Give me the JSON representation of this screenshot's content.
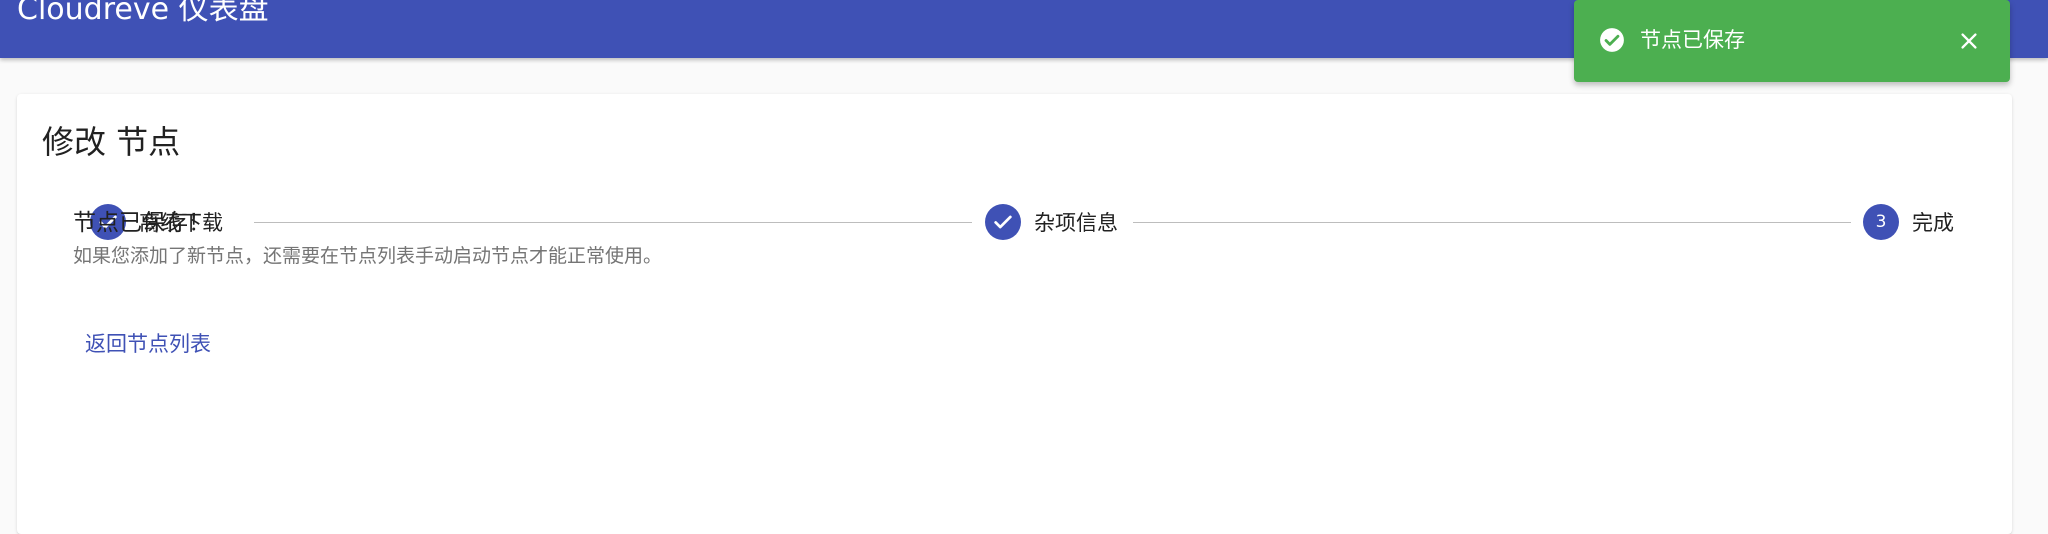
{
  "appbar": {
    "title": "Cloudreve 仪表盘",
    "color": "#3f51b5"
  },
  "card": {
    "title": "修改 节点"
  },
  "stepper": {
    "steps": [
      {
        "label": "离线下载",
        "state": "completed",
        "icon": "check-icon"
      },
      {
        "label": "杂项信息",
        "state": "completed",
        "icon": "check-icon"
      },
      {
        "label": "完成",
        "state": "active",
        "number": "3"
      }
    ],
    "accent": "#3f51b5"
  },
  "result": {
    "title": "节点已保存！",
    "description": "如果您添加了新节点，还需要在节点列表手动启动节点才能正常使用。",
    "back_link": "返回节点列表"
  },
  "snackbar": {
    "message": "节点已保存",
    "color": "#4caf50",
    "icon": "check-circle-icon",
    "close_icon": "close-icon"
  }
}
